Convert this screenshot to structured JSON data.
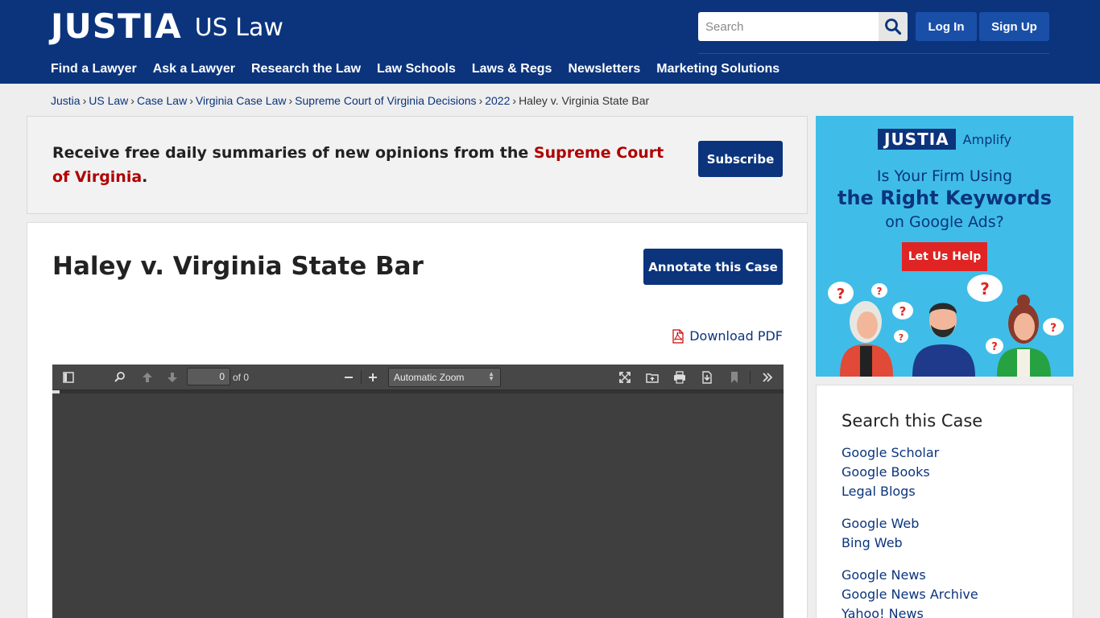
{
  "header": {
    "logo": "JUSTIA",
    "logo_sub": "US Law",
    "search_placeholder": "Search",
    "login": "Log In",
    "signup": "Sign Up",
    "nav": [
      "Find a Lawyer",
      "Ask a Lawyer",
      "Research the Law",
      "Law Schools",
      "Laws & Regs",
      "Newsletters",
      "Marketing Solutions"
    ]
  },
  "breadcrumb": {
    "links": [
      "Justia",
      "US Law",
      "Case Law",
      "Virginia Case Law",
      "Supreme Court of Virginia Decisions",
      "2022"
    ],
    "current": "Haley v. Virginia State Bar",
    "separator": "›"
  },
  "subscribe": {
    "text_before": "Receive free daily summaries of new opinions from the ",
    "court": "Supreme Court of Virginia",
    "text_after": ".",
    "button": "Subscribe"
  },
  "case": {
    "title": "Haley v. Virginia State Bar",
    "annotate_button": "Annotate this Case",
    "download": "Download PDF"
  },
  "pdf_viewer": {
    "page_number": "0",
    "page_total_label": "of 0",
    "zoom": "Automatic Zoom",
    "load_progress": 0.01
  },
  "ad": {
    "logo": "JUSTIA",
    "logo_sub": "Amplify",
    "line1": "Is Your Firm Using",
    "line2": "the Right Keywords",
    "line3": "on Google Ads?",
    "cta": "Let Us Help"
  },
  "search_case": {
    "title": "Search this Case",
    "groups": [
      [
        "Google Scholar",
        "Google Books",
        "Legal Blogs"
      ],
      [
        "Google Web",
        "Bing Web"
      ],
      [
        "Google News",
        "Google News Archive",
        "Yahoo! News"
      ]
    ]
  },
  "colors": {
    "brand_navy": "#0b347d",
    "link_red": "#b00000",
    "ad_blue": "#3fbde8",
    "ad_red": "#e02424"
  }
}
